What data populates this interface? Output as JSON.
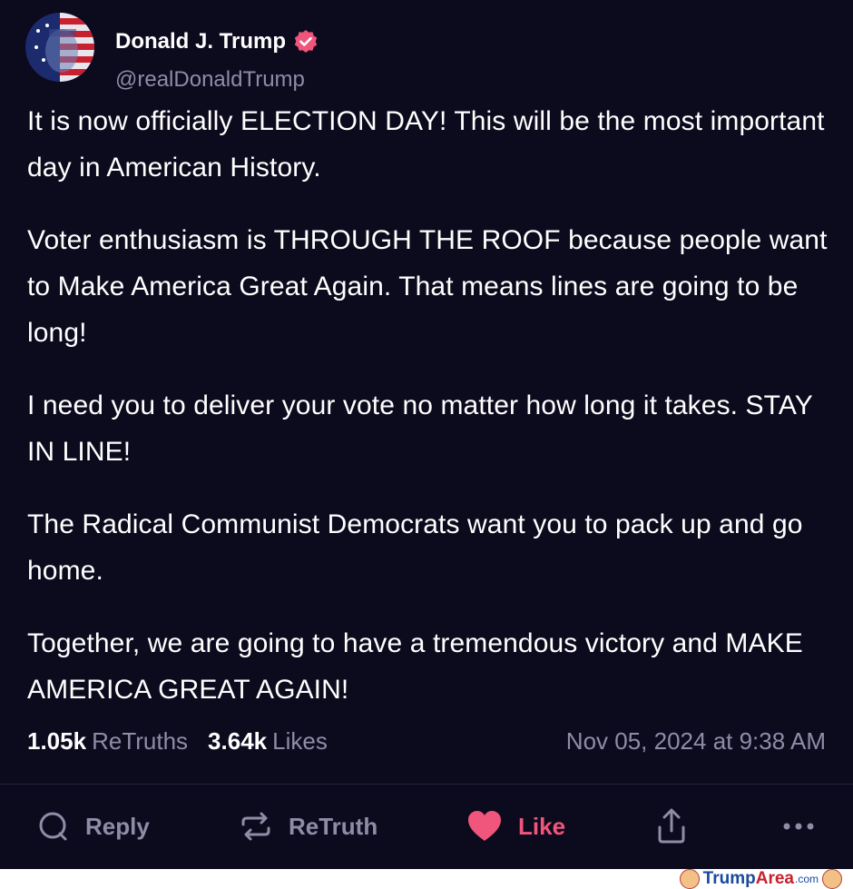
{
  "post": {
    "author": {
      "name": "Donald J. Trump",
      "handle": "@realDonaldTrump"
    },
    "paragraphs": [
      "It is now officially ELECTION DAY! This will be the most important day in American History.",
      "Voter enthusiasm is THROUGH THE ROOF because people want to Make America Great Again. That means lines are going to be long!",
      "I need you to deliver your vote no matter how long it takes. STAY IN LINE!",
      "The Radical Communist Democrats want you to pack up and go home.",
      "Together, we are going to have a tremendous victory and MAKE AMERICA GREAT AGAIN!"
    ],
    "stats": {
      "retruths_count": "1.05k",
      "retruths_label": "ReTruths",
      "likes_count": "3.64k",
      "likes_label": "Likes"
    },
    "timestamp": "Nov 05, 2024 at 9:38 AM"
  },
  "actions": {
    "reply_label": "Reply",
    "retruth_label": "ReTruth",
    "like_label": "Like"
  },
  "footer": {
    "brand_a": "Trump",
    "brand_b": "Area",
    "brand_c": ".com"
  },
  "colors": {
    "background": "#0c0a1d",
    "accent_like": "#f0557b",
    "muted": "#8f8ca8",
    "verified": "#f0557b"
  },
  "icons": [
    "verified-badge-icon",
    "reply-icon",
    "retruth-icon",
    "heart-icon",
    "share-icon",
    "more-icon"
  ]
}
